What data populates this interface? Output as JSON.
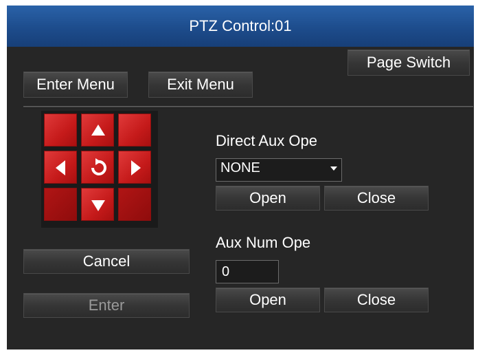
{
  "window": {
    "title": "PTZ Control:01"
  },
  "buttons": {
    "page_switch": "Page Switch",
    "enter_menu": "Enter Menu",
    "exit_menu": "Exit Menu",
    "cancel": "Cancel",
    "enter": "Enter"
  },
  "direct_aux": {
    "label": "Direct Aux Ope",
    "selected": "NONE",
    "open": "Open",
    "close": "Close"
  },
  "aux_num": {
    "label": "Aux Num Ope",
    "value": "0",
    "open": "Open",
    "close": "Close"
  },
  "colors": {
    "title_bar": "#1d4c8c",
    "panel": "#262626",
    "pad_red": "#c51a1a"
  }
}
